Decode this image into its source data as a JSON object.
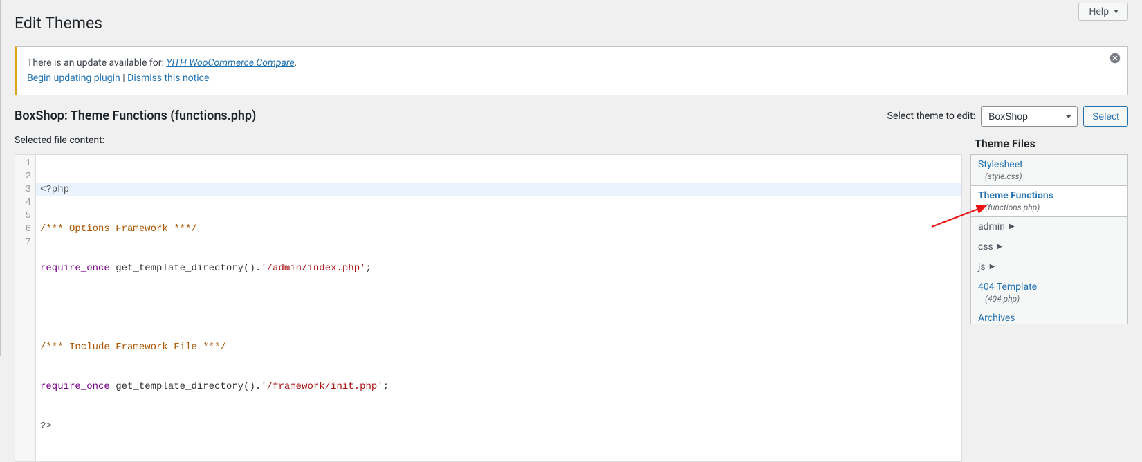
{
  "help_label": "Help",
  "page_title": "Edit Themes",
  "notice": {
    "line1_pre": "There is an update available for: ",
    "plugin": "YITH WooCommerce Compare",
    "line1_post": ".",
    "update_link": "Begin updating plugin",
    "sep": " | ",
    "dismiss_link": "Dismiss this notice"
  },
  "file_heading": "BoxShop: Theme Functions (functions.php)",
  "theme_select": {
    "label": "Select theme to edit:",
    "value": "BoxShop",
    "button": "Select"
  },
  "selected_file_label": "Selected file content:",
  "code": {
    "l1": "<?php",
    "l2": "/*** Options Framework ***/",
    "l3a": "require_once",
    "l3b": " get_template_directory().",
    "l3c": "'/admin/index.php'",
    "l3d": ";",
    "l4": "",
    "l5": "/*** Include Framework File ***/",
    "l6a": "require_once",
    "l6b": " get_template_directory().",
    "l6c": "'/framework/init.php'",
    "l6d": ";",
    "l7": "?>"
  },
  "sidebar_title": "Theme Files",
  "files": {
    "stylesheet": {
      "name": "Stylesheet",
      "hint": "(style.css)"
    },
    "functions": {
      "name": "Theme Functions",
      "hint": "(functions.php)"
    },
    "admin": "admin",
    "css": "css",
    "js": "js",
    "tpl404": {
      "name": "404 Template",
      "hint": "(404.php)"
    },
    "archives": "Archives"
  },
  "gutter": [
    "1",
    "2",
    "3",
    "4",
    "5",
    "6",
    "7"
  ]
}
